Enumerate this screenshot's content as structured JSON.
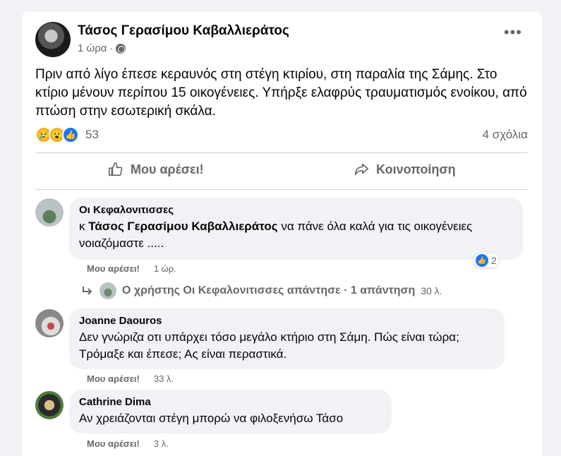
{
  "post": {
    "author": "Τάσος Γερασίμου Καβαλλιεράτος",
    "time": "1 ώρα",
    "privacy_icon": "globe-icon",
    "more_icon": "more-options-icon",
    "text": "Πριν από λίγο έπεσε κεραυνός στη στέγη κτιρίου, στη παραλία της Σάμης. Στο κτίριο μένουν περίπου 15 οικογένειες. Υπήρξε ελαφρύς τραυματισμός ενοίκου, από πτώση στην εσωτερική σκάλα.",
    "reactions_count": "53",
    "comments_count": "4 σχόλια",
    "reaction_icons": [
      "sad-icon",
      "wow-icon",
      "like-icon"
    ]
  },
  "actions": {
    "like": "Μου αρέσει!",
    "share": "Κοινοποίηση"
  },
  "comments": [
    {
      "name": "Οι Κεφαλονιτισσες",
      "mention_prefix": "κ",
      "mention": "Τάσος Γερασίμου Καβαλλιεράτος",
      "text": "να πάνε όλα καλά για τις οικογένειες νοιαζόμαστε .....",
      "like_label": "Μου αρέσει!",
      "time": "1 ώρ.",
      "reaction_count": "2",
      "reply_text": "Ο χρήστης Οι Κεφαλονιτισσες απάντησε · 1 απάντηση",
      "reply_time": "30 λ."
    },
    {
      "name": "Joanne Daouros",
      "text": "Δεν γνώριζα οτι υπάρχει τόσο μεγάλο κτήριο στη Σάμη. Πώς είναι τώρα; Τρόμαξε και έπεσε; Ας είναι περαστικά.",
      "like_label": "Μου αρέσει!",
      "time": "33 λ."
    },
    {
      "name": "Cathrine Dima",
      "text": "Αν χρειάζονται στέγη μπορώ να φιλοξενήσω Τάσο",
      "like_label": "Μου αρέσει!",
      "time": "3 λ."
    }
  ],
  "colors": {
    "background": "#f0f2f5",
    "card": "#ffffff",
    "secondary_text": "#65676b",
    "accent": "#1877f2"
  }
}
